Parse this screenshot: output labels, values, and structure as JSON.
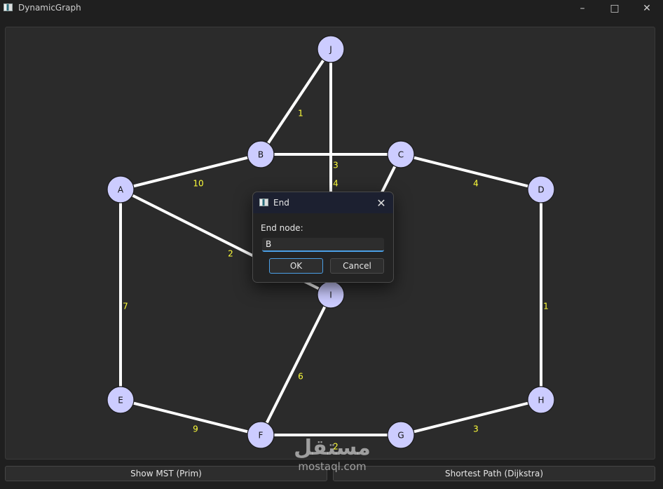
{
  "window": {
    "title": "DynamicGraph",
    "controls": [
      "minimize",
      "maximize",
      "close"
    ]
  },
  "graph": {
    "nodes": [
      {
        "id": "A",
        "label": "A",
        "color": "#ccccff"
      },
      {
        "id": "B",
        "label": "B",
        "color": "#ccccff"
      },
      {
        "id": "C",
        "label": "C",
        "color": "#ccccff"
      },
      {
        "id": "D",
        "label": "D",
        "color": "#ccccff"
      },
      {
        "id": "E",
        "label": "E",
        "color": "#ccccff"
      },
      {
        "id": "F",
        "label": "F",
        "color": "#ccccff"
      },
      {
        "id": "G",
        "label": "G",
        "color": "#ccccff"
      },
      {
        "id": "H",
        "label": "H",
        "color": "#ccccff"
      },
      {
        "id": "I",
        "label": "I",
        "color": "#ccccff"
      },
      {
        "id": "J",
        "label": "J",
        "color": "#ccccff"
      }
    ],
    "edges": [
      {
        "from": "J",
        "to": "B",
        "weight": "1"
      },
      {
        "from": "J",
        "to": "I",
        "weight": "4"
      },
      {
        "from": "B",
        "to": "C",
        "weight": "3"
      },
      {
        "from": "A",
        "to": "B",
        "weight": "10"
      },
      {
        "from": "C",
        "to": "D",
        "weight": "4"
      },
      {
        "from": "C",
        "to": "I",
        "weight": ""
      },
      {
        "from": "A",
        "to": "I",
        "weight": "2"
      },
      {
        "from": "A",
        "to": "E",
        "weight": "7"
      },
      {
        "from": "D",
        "to": "H",
        "weight": "1"
      },
      {
        "from": "I",
        "to": "F",
        "weight": "6"
      },
      {
        "from": "E",
        "to": "F",
        "weight": "9"
      },
      {
        "from": "F",
        "to": "G",
        "weight": "2"
      },
      {
        "from": "G",
        "to": "H",
        "weight": "3"
      }
    ],
    "edge_color": "#ffffff",
    "weight_color": "#ffff3a"
  },
  "buttons": {
    "mst_label": "Show MST (Prim)",
    "shortest_label": "Shortest Path (Dijkstra)"
  },
  "dialog": {
    "title": "End",
    "prompt": "End node:",
    "input_value": "B",
    "ok_label": "OK",
    "cancel_label": "Cancel",
    "accent": "#4b9fe6"
  },
  "watermark": {
    "arabic": "مستقل",
    "latin": "mostaql.com"
  }
}
